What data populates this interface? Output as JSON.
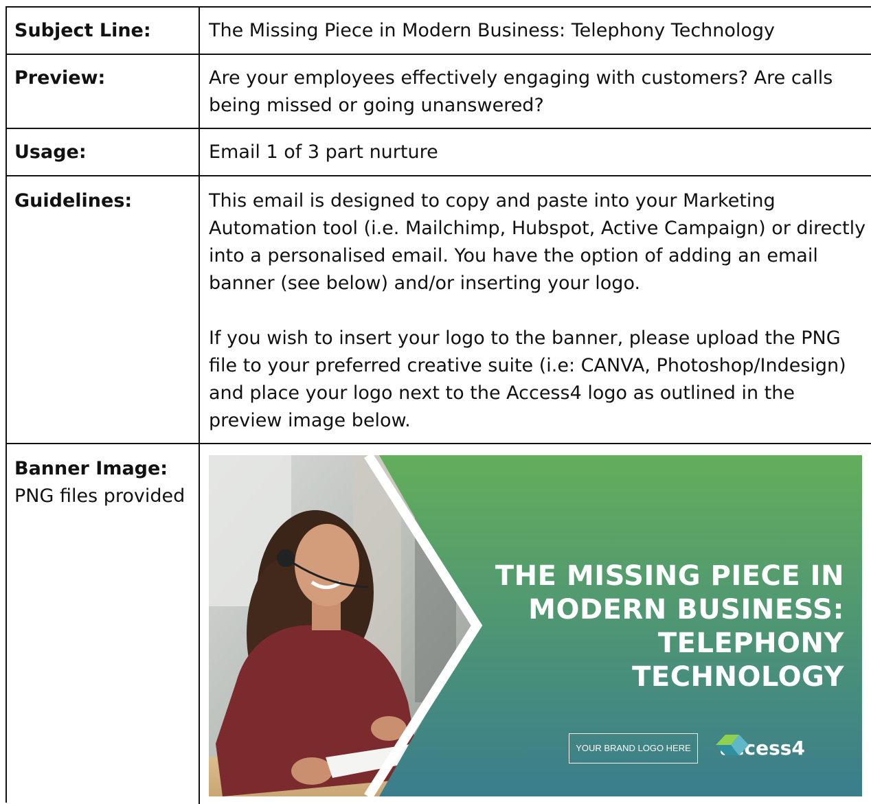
{
  "rows": {
    "subject": {
      "label": "Subject Line:",
      "value": "The Missing Piece in Modern Business: Telephony Technology"
    },
    "preview": {
      "label": "Preview:",
      "value": "Are your employees effectively engaging with customers? Are calls being missed or going unanswered?"
    },
    "usage": {
      "label": "Usage:",
      "value": "Email 1 of 3 part nurture"
    },
    "guidelines": {
      "label": "Guidelines:",
      "para1": "This email is designed to copy and paste into your Marketing Automation tool (i.e. Mailchimp, Hubspot, Active Campaign) or directly into a personalised email. You have the option of adding an email banner (see below) and/or inserting your logo.",
      "para2": "If you wish to insert your logo to the banner, please upload the PNG file to your preferred creative suite (i.e: CANVA, Photoshop/Indesign) and place your logo next to the Access4 logo as outlined in the preview image below."
    },
    "banner": {
      "label": "Banner Image:",
      "sublabel": "PNG files provided"
    }
  },
  "banner_image": {
    "headline_lines": [
      "THE MISSING PIECE IN",
      "MODERN BUSINESS:",
      "TELEPHONY",
      "TECHNOLOGY"
    ],
    "brand_placeholder": "YOUR BRAND LOGO HERE",
    "logo_text": "access4",
    "colors": {
      "gradient_top": "#62ad5c",
      "gradient_bottom": "#3a7e8c",
      "shirt": "#7b2a2e"
    }
  }
}
